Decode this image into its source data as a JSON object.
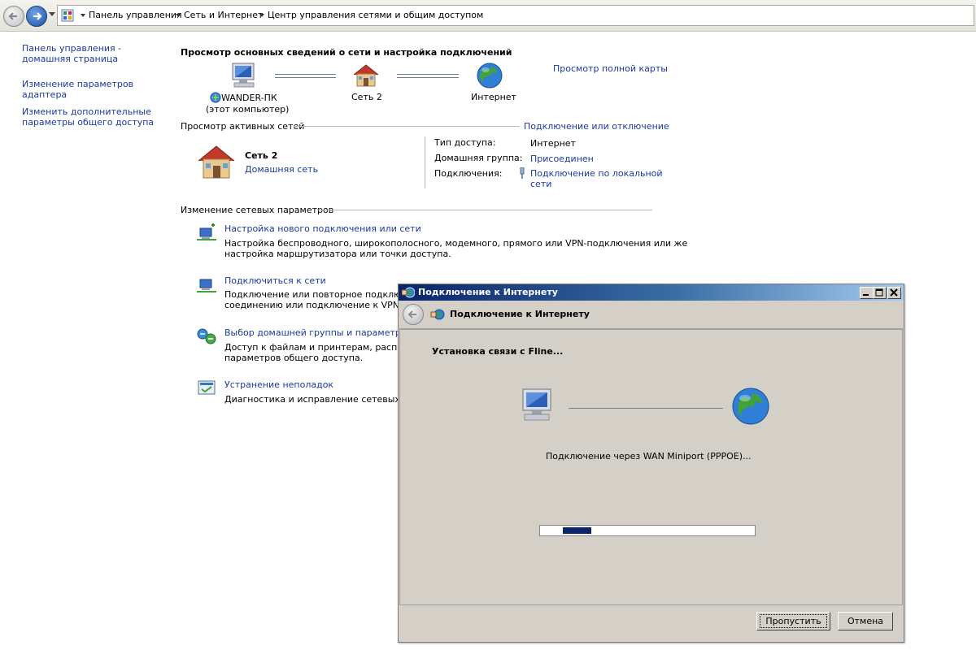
{
  "breadcrumb": [
    "Панель управления",
    "Сеть и Интернет",
    "Центр управления сетями и общим доступом"
  ],
  "sidebar": {
    "items": [
      {
        "label": "Панель управления - домашняя страница"
      },
      {
        "label": "Изменение параметров адаптера"
      },
      {
        "label": "Изменить дополнительные параметры общего доступа"
      }
    ]
  },
  "main": {
    "title": "Просмотр основных сведений о сети и настройка подключений",
    "full_map_link": "Просмотр полной карты",
    "map": {
      "computer_name": "WANDER-ПК",
      "computer_sub": "(этот компьютер)",
      "network": "Сеть  2",
      "internet": "Интернет"
    },
    "active_header": "Просмотр активных сетей",
    "connect_link": "Подключение или отключение",
    "active_network": {
      "name": "Сеть  2",
      "type": "Домашняя сеть",
      "access_label": "Тип доступа:",
      "access_value": "Интернет",
      "homegroup_label": "Домашняя группа:",
      "homegroup_value": "Присоединен",
      "connections_label": "Подключения:",
      "connections_value_line1": "Подключение по локальной",
      "connections_value_line2": "сети"
    },
    "change_header": "Изменение сетевых параметров",
    "tasks": [
      {
        "title": "Настройка нового подключения или сети",
        "desc1": "Настройка беспроводного, широкополосного, модемного, прямого или VPN-подключения или же",
        "desc2": "настройка маршрутизатора или точки доступа."
      },
      {
        "title": "Подключиться к сети",
        "desc1": "Подключение или повторное подключение",
        "desc2": "соединению или подключение к VPN."
      },
      {
        "title": "Выбор домашней группы и параметров об",
        "desc1": "Доступ к файлам и принтерам, располож",
        "desc2": "параметров общего доступа."
      },
      {
        "title": "Устранение неполадок",
        "desc1": "Диагностика и исправление сетевых проб",
        "desc2": ""
      }
    ]
  },
  "dialog": {
    "title": "Подключение к Интернету",
    "header_title": "Подключение к Интернету",
    "status_title": "Установка связи с Fline...",
    "status_detail": "Подключение через WAN Miniport (PPPOE)...",
    "progress": 0.15,
    "skip_label": "Пропустить",
    "cancel_label": "Отмена"
  },
  "colors": {
    "link": "#1a3a9c",
    "title_bar_start": "#0a246a",
    "progress_fill": "#0a246a"
  }
}
